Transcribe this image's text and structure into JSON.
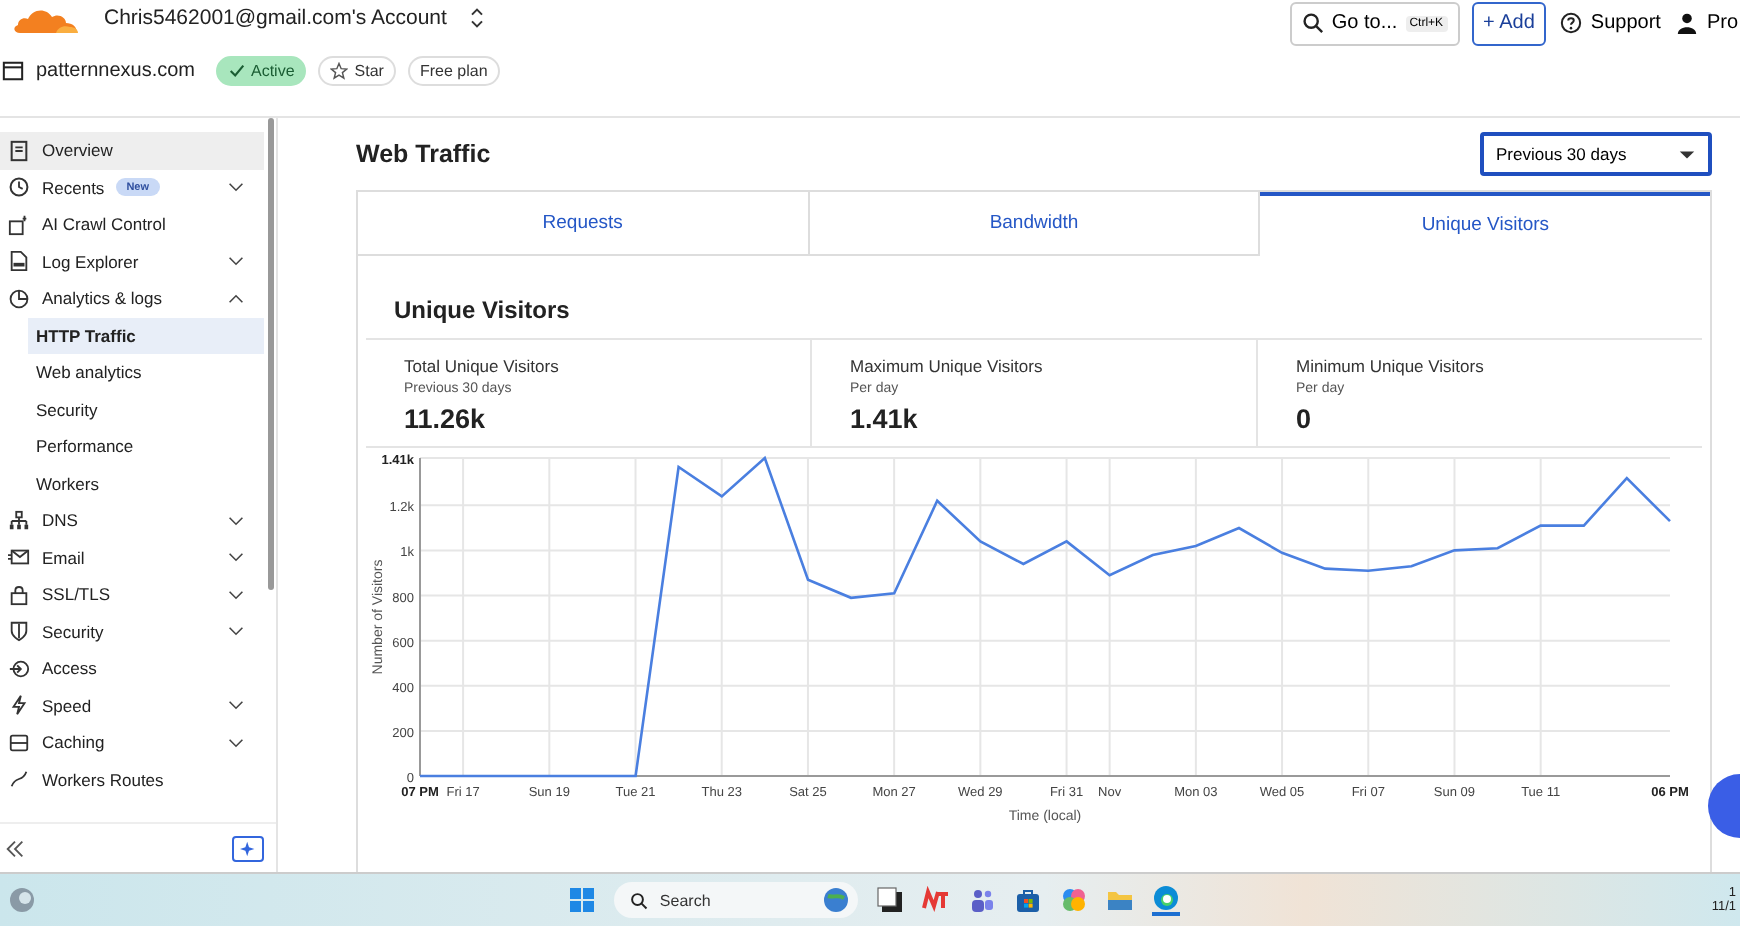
{
  "header": {
    "account": "Chris5462001@gmail.com's Account",
    "goto": {
      "label": "Go to...",
      "shortcut": "Ctrl+K"
    },
    "add": "+ Add",
    "support": "Support",
    "profile": "Pro"
  },
  "zone": {
    "domain": "patternnexus.com",
    "status": "Active",
    "star": "Star",
    "plan": "Free plan"
  },
  "sidebar": {
    "items": [
      {
        "label": "Overview",
        "highlighted": true,
        "expandable": false
      },
      {
        "label": "Recents",
        "badge": "New",
        "highlighted": false,
        "expandable": true,
        "expanded": false
      },
      {
        "label": "AI Crawl Control",
        "highlighted": false,
        "expandable": false
      },
      {
        "label": "Log Explorer",
        "highlighted": false,
        "expandable": true,
        "expanded": false
      },
      {
        "label": "Analytics & logs",
        "highlighted": false,
        "expandable": true,
        "expanded": true,
        "children": [
          {
            "label": "HTTP Traffic",
            "selected": true
          },
          {
            "label": "Web analytics",
            "selected": false
          },
          {
            "label": "Security",
            "selected": false
          },
          {
            "label": "Performance",
            "selected": false
          },
          {
            "label": "Workers",
            "selected": false
          }
        ]
      },
      {
        "label": "DNS",
        "highlighted": false,
        "expandable": true,
        "expanded": false
      },
      {
        "label": "Email",
        "highlighted": false,
        "expandable": true,
        "expanded": false
      },
      {
        "label": "SSL/TLS",
        "highlighted": false,
        "expandable": true,
        "expanded": false
      },
      {
        "label": "Security",
        "highlighted": false,
        "expandable": true,
        "expanded": false
      },
      {
        "label": "Access",
        "highlighted": false,
        "expandable": false
      },
      {
        "label": "Speed",
        "highlighted": false,
        "expandable": true,
        "expanded": false
      },
      {
        "label": "Caching",
        "highlighted": false,
        "expandable": true,
        "expanded": false
      },
      {
        "label": "Workers Routes",
        "highlighted": false,
        "expandable": false
      }
    ]
  },
  "page": {
    "title": "Web Traffic",
    "range": "Previous 30 days"
  },
  "tabs": [
    {
      "label": "Requests",
      "selected": false
    },
    {
      "label": "Bandwidth",
      "selected": false
    },
    {
      "label": "Unique Visitors",
      "selected": true
    }
  ],
  "panel": {
    "title": "Unique Visitors",
    "stats": [
      {
        "label": "Total Unique Visitors",
        "sublabel": "Previous 30 days",
        "value": "11.26k"
      },
      {
        "label": "Maximum Unique Visitors",
        "sublabel": "Per day",
        "value": "1.41k"
      },
      {
        "label": "Minimum Unique Visitors",
        "sublabel": "Per day",
        "value": "0"
      }
    ],
    "chart_data": {
      "type": "line",
      "xlabel": "Time (local)",
      "ylabel": "Number of Visitors",
      "grid": true,
      "categories": [
        "07 PM",
        "Fri 17",
        null,
        "Sun 19",
        null,
        "Tue 21",
        null,
        "Thu 23",
        null,
        "Sat 25",
        null,
        "Mon 27",
        null,
        "Wed 29",
        null,
        "Fri 31",
        "Nov",
        null,
        "Mon 03",
        null,
        "Wed 05",
        null,
        "Fri 07",
        null,
        "Sun 09",
        null,
        "Tue 11",
        null,
        null,
        "06 PM"
      ],
      "values": [
        0,
        0,
        0,
        0,
        0,
        0,
        1370,
        1240,
        1410,
        870,
        790,
        810,
        1220,
        1040,
        940,
        1040,
        890,
        980,
        1020,
        1100,
        990,
        920,
        910,
        930,
        1000,
        1010,
        1110,
        1110,
        1320,
        1130
      ],
      "ylim": [
        0,
        1410
      ],
      "yticks": [
        0,
        200,
        400,
        600,
        800,
        {
          "value": 1000,
          "label": "1k"
        },
        {
          "value": 1200,
          "label": "1.2k"
        },
        {
          "value": 1410,
          "label": "1.41k"
        }
      ]
    }
  },
  "taskbar": {
    "search": "Search",
    "clock": [
      "1",
      "11/1"
    ]
  }
}
